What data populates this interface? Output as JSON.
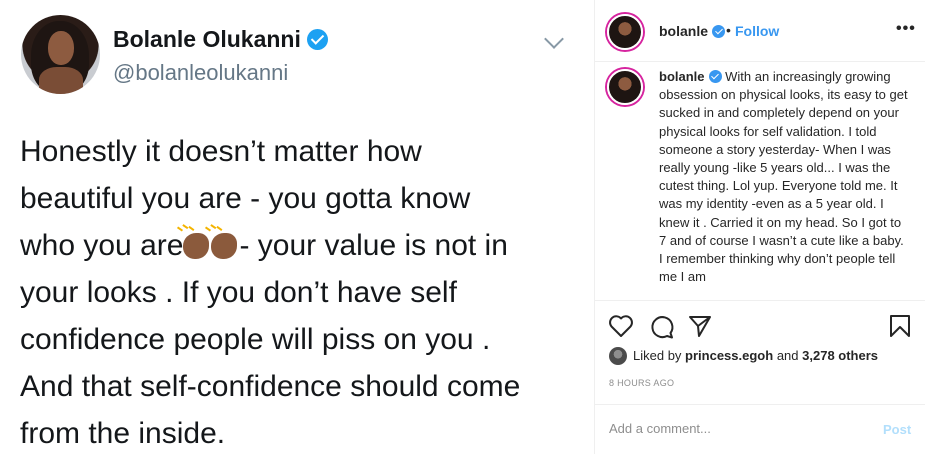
{
  "tweet": {
    "name": "Bolanle Olukanni",
    "handle": "@bolanleolukanni",
    "lines": {
      "l1": "Honestly it doesn’t matter how",
      "l2": "beautiful you are - you gotta know",
      "l3a": "who you are",
      "l3b": "- your value is not in",
      "l4": "your looks . If you don’t have self",
      "l5": "confidence people will piss on you .",
      "l6": "And that self-confidence should come",
      "l7": "from the inside."
    },
    "emoji_icon": "clapping-hands-emoji"
  },
  "instagram": {
    "username": "bolanle",
    "separator": "•",
    "follow_label": "Follow",
    "more_label": "•••",
    "caption": "With an increasingly growing obsession on physical looks, its easy to get sucked in and completely depend on your physical looks for self validation. I told someone a story yesterday- When I was really young -like 5 years old... I was the cutest thing. Lol yup. Everyone told me. It was my identity -even as a 5 year old. I knew it . Carried it on my head. So I got to 7 and of course I wasn’t a cute like a baby. I remember thinking why don’t people tell me I am",
    "likes": {
      "prefix": "Liked by",
      "liker": "princess.egoh",
      "connector": "and",
      "others": "3,278 others"
    },
    "time": "8 HOURS AGO",
    "comment_placeholder": "Add a comment...",
    "post_label": "Post",
    "icons": [
      "heart-icon",
      "comment-icon",
      "share-icon",
      "bookmark-icon"
    ],
    "colors": {
      "link": "#3897f0",
      "post_disabled": "#b2dffc",
      "verified": "#3897f0",
      "muted": "#8e8e8e"
    }
  }
}
